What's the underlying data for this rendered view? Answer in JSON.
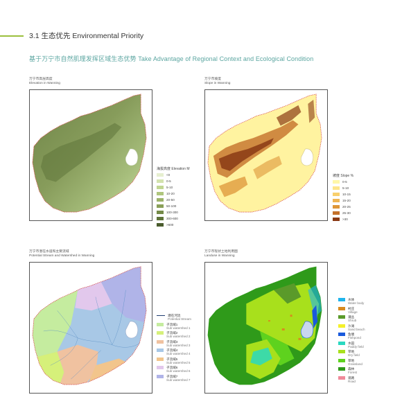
{
  "header": {
    "title": "3.1 生态优先 Environmental Priority",
    "subtitle": "基于万宁市自然肌理发挥区域生态优势  Take Advantage of Regional Context and Ecological Condition"
  },
  "colors": {
    "accent_line": "#9bbf3c",
    "subtitle": "#5aa5a0",
    "boundary": "#d9534f"
  },
  "maps": {
    "elevation": {
      "caption_cn": "万宁市高层高度",
      "caption_en": "Elevation in Wanning",
      "legend_title": "海拔高度 Elevation M",
      "legend": [
        {
          "label": "<0",
          "color": "#e6efcf"
        },
        {
          "label": "0-5",
          "color": "#d3e2ae"
        },
        {
          "label": "5-10",
          "color": "#c1d693"
        },
        {
          "label": "10-20",
          "color": "#afc67d"
        },
        {
          "label": "20-50",
          "color": "#9cb36a"
        },
        {
          "label": "50-100",
          "color": "#899f58"
        },
        {
          "label": "100-300",
          "color": "#748a48"
        },
        {
          "label": "300-600",
          "color": "#5f743a"
        },
        {
          "label": ">600",
          "color": "#4a5c2d"
        }
      ]
    },
    "slope": {
      "caption_cn": "万宁市坡度",
      "caption_en": "Slope in Wanning",
      "legend_title": "坡度 Slope %",
      "legend": [
        {
          "label": "0-5",
          "color": "#fff7a8"
        },
        {
          "label": "5-10",
          "color": "#fde58a"
        },
        {
          "label": "10-15",
          "color": "#f8cf6c"
        },
        {
          "label": "15-20",
          "color": "#efb553"
        },
        {
          "label": "20-25",
          "color": "#de9638"
        },
        {
          "label": "25-30",
          "color": "#c4712a"
        },
        {
          "label": ">30",
          "color": "#8a3a14"
        }
      ]
    },
    "watershed": {
      "caption_cn": "万宁市潜在水道和主要流域",
      "caption_en": "Potential Stream and Watershed in Wanning",
      "legend": [
        {
          "cn": "潜在河流",
          "en": "Potential Stream",
          "color": "#1e3b6e",
          "kind": "line"
        },
        {
          "cn": "子流域1",
          "en": "Sub watershed 1",
          "color": "#c5ec9f"
        },
        {
          "cn": "子流域2",
          "en": "Sub watershed 2",
          "color": "#d6f07a"
        },
        {
          "cn": "子流域3",
          "en": "Sub watershed 3",
          "color": "#f0c2a0"
        },
        {
          "cn": "子流域4",
          "en": "Sub watershed 4",
          "color": "#a8c8e6"
        },
        {
          "cn": "子流域5",
          "en": "Sub watershed 5",
          "color": "#f2c58c"
        },
        {
          "cn": "子流域6",
          "en": "Sub watershed 6",
          "color": "#e2c8ec"
        },
        {
          "cn": "子流域7",
          "en": "Sub watershed 7",
          "color": "#b0b4e8"
        }
      ]
    },
    "landuse": {
      "caption_cn": "万宁市现状土地利用图",
      "caption_en": "Landuse in Wanning",
      "legend": [
        {
          "cn": "水体",
          "en": "Water body",
          "color": "#1fb4ec"
        },
        {
          "cn": "村庄",
          "en": "Village",
          "color": "#d98a1e"
        },
        {
          "cn": "灌丛",
          "en": "Shrub",
          "color": "#5a9a2a"
        },
        {
          "cn": "沙滩",
          "en": "Sand beach",
          "color": "#f4f02a"
        },
        {
          "cn": "鱼塘",
          "en": "Fishpond",
          "color": "#1a5adc"
        },
        {
          "cn": "水田",
          "en": "Paddy field",
          "color": "#2ad8c0"
        },
        {
          "cn": "旱地",
          "en": "Dry field",
          "color": "#a8e01c"
        },
        {
          "cn": "草地",
          "en": "Grassland",
          "color": "#5ed21e"
        },
        {
          "cn": "森林",
          "en": "Forest",
          "color": "#2f9a1a"
        },
        {
          "cn": "道路",
          "en": "Road",
          "color": "#f08a9a"
        }
      ]
    }
  }
}
